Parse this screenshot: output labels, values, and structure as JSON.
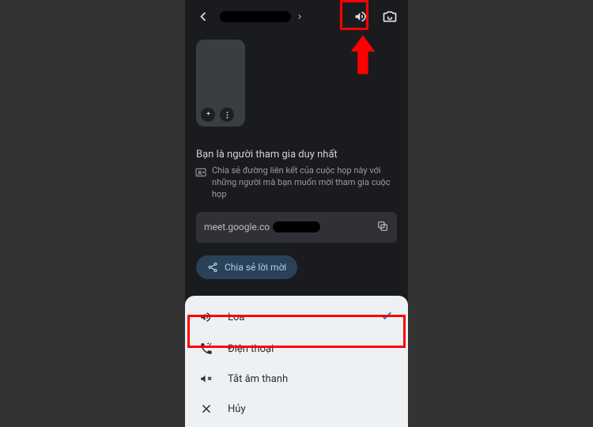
{
  "status": {
    "title": "Bạn là người tham gia duy nhất",
    "share_hint": "Chia sẻ đường liên kết của cuộc họp này với những người mà bạn muốn mời tham gia cuộc họp"
  },
  "link": {
    "text": "meet.google.co"
  },
  "actions": {
    "share_invite": "Chia sẻ lời mời"
  },
  "audio_sheet": {
    "options": [
      {
        "icon": "speaker-icon",
        "label": "Loa",
        "selected": true
      },
      {
        "icon": "phone-icon",
        "label": "Điện thoại",
        "selected": false
      },
      {
        "icon": "mute-icon",
        "label": "Tắt âm thanh",
        "selected": false
      },
      {
        "icon": "close-icon",
        "label": "Hủy",
        "selected": false
      }
    ]
  }
}
